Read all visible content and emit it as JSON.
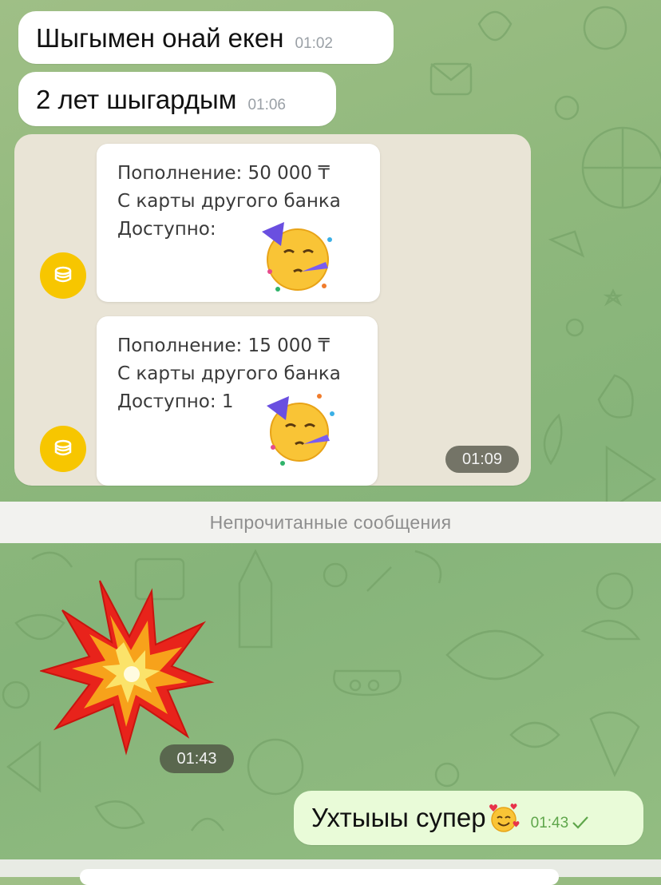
{
  "messages": {
    "in1": {
      "text": "Шыгымен онай екен",
      "time": "01:02"
    },
    "in2": {
      "text": "2 лет шыгардым",
      "time": "01:06"
    },
    "photo": {
      "time": "01:09",
      "card1": {
        "line1": "Пополнение: 50 000 ₸",
        "line2": "С карты другого банка",
        "line3": "Доступно:"
      },
      "card2": {
        "line1": "Пополнение: 15 000 ₸",
        "line2": "С карты другого банка",
        "line3": "Доступно: 1"
      }
    },
    "sticker": {
      "icon": "explosion-sticker",
      "time": "01:43"
    },
    "out1": {
      "text": "Ухтыыы супер",
      "time": "01:43",
      "status_icon": "check-icon"
    }
  },
  "unread_divider": "Непрочитанные сообщения",
  "colors": {
    "background": "#8fb87c",
    "incoming_bubble": "#ffffff",
    "outgoing_bubble": "#e9fbd8",
    "coin": "#f7c600"
  }
}
